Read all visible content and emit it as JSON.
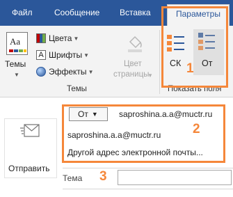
{
  "tabs": [
    "Файл",
    "Сообщение",
    "Вставка",
    "Параметры"
  ],
  "ribbon": {
    "themes_group": {
      "themes_button": "Темы",
      "colors": "Цвета",
      "fonts": "Шрифты",
      "effects": "Эффекты",
      "page_color_line1": "Цвет",
      "page_color_line2": "страницы",
      "group_label": "Темы"
    },
    "show_fields_group": {
      "cc_button": "СК",
      "from_button": "От",
      "group_label": "Показать поля"
    }
  },
  "compose": {
    "send_button": "Отправить",
    "from_button": "От",
    "from_email": "saproshina.a.a@muctr.ru",
    "dropdown_email": "saproshina.a.a@muctr.ru",
    "dropdown_other": "Другой адрес электронной почты...",
    "subject_label": "Тема"
  },
  "annotations": [
    "1",
    "2",
    "3"
  ],
  "colors": {
    "accent": "#2b579a",
    "highlight": "#f5873a"
  }
}
